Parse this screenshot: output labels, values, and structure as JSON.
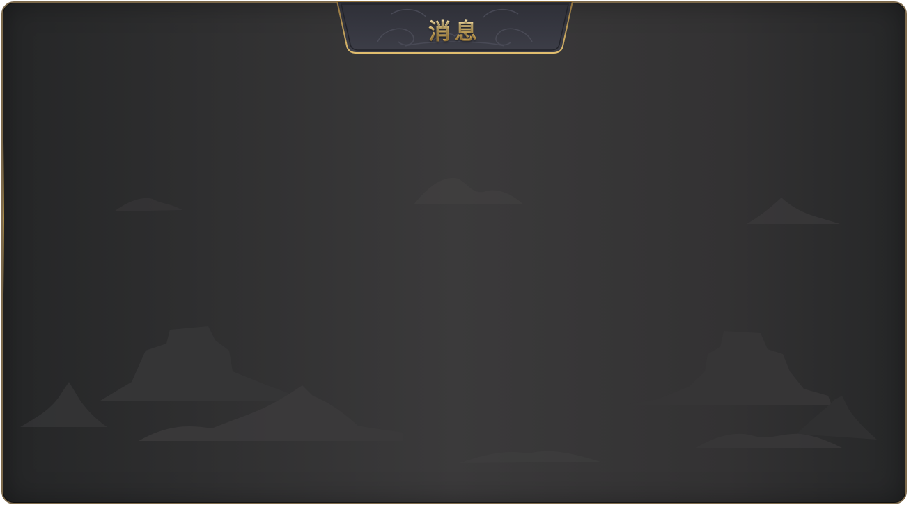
{
  "dialog": {
    "title": "消息"
  },
  "colors": {
    "frame_border": "#7d6a4c",
    "panel_background": "#333233",
    "title_gold": "#e7c16d",
    "accent_gold": "#c9a75a"
  },
  "icons": {
    "decor": "mountain-silhouette-decoration"
  }
}
